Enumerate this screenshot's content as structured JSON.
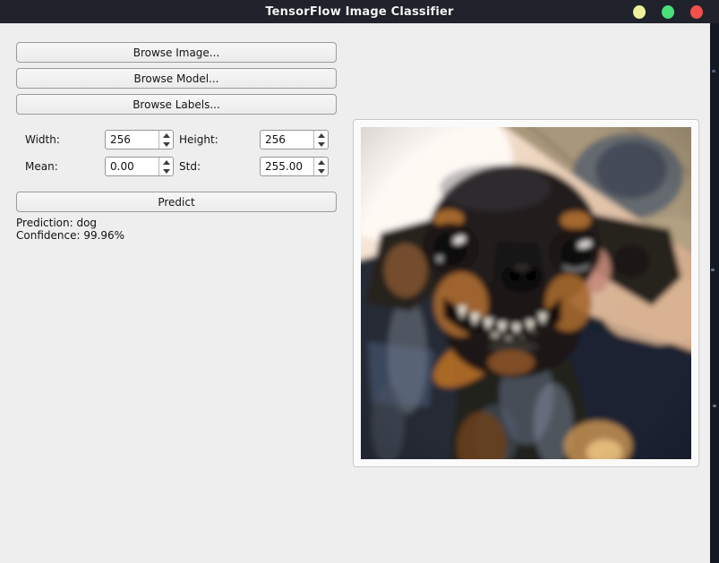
{
  "window": {
    "title": "TensorFlow Image Classifier",
    "controls": [
      {
        "name": "minimize",
        "color": "#eef09c"
      },
      {
        "name": "maximize",
        "color": "#4ae07c"
      },
      {
        "name": "close",
        "color": "#f25048"
      }
    ]
  },
  "colors": {
    "titlebar_bg": "#20232b",
    "window_bg": "#eeeeee",
    "desktop_strip": "#141822",
    "button_border": "#9b9b9b"
  },
  "buttons": {
    "browse_image": "Browse Image...",
    "browse_model": "Browse Model...",
    "browse_labels": "Browse Labels...",
    "predict": "Predict"
  },
  "fields": {
    "width": {
      "label": "Width:",
      "value": "256"
    },
    "height": {
      "label": "Height:",
      "value": "256"
    },
    "mean": {
      "label": "Mean:",
      "value": "0.00"
    },
    "std": {
      "label": "Std:",
      "value": "255.00"
    }
  },
  "results": {
    "prediction": "Prediction: dog",
    "confidence": "Confidence: 99.96%"
  },
  "image_panel": {
    "description": "Photo of a smiling black-and-tan chihuahua dog being held, a person's arm crossing diagonally, tan tiled floor at top right and dark navy background below"
  }
}
